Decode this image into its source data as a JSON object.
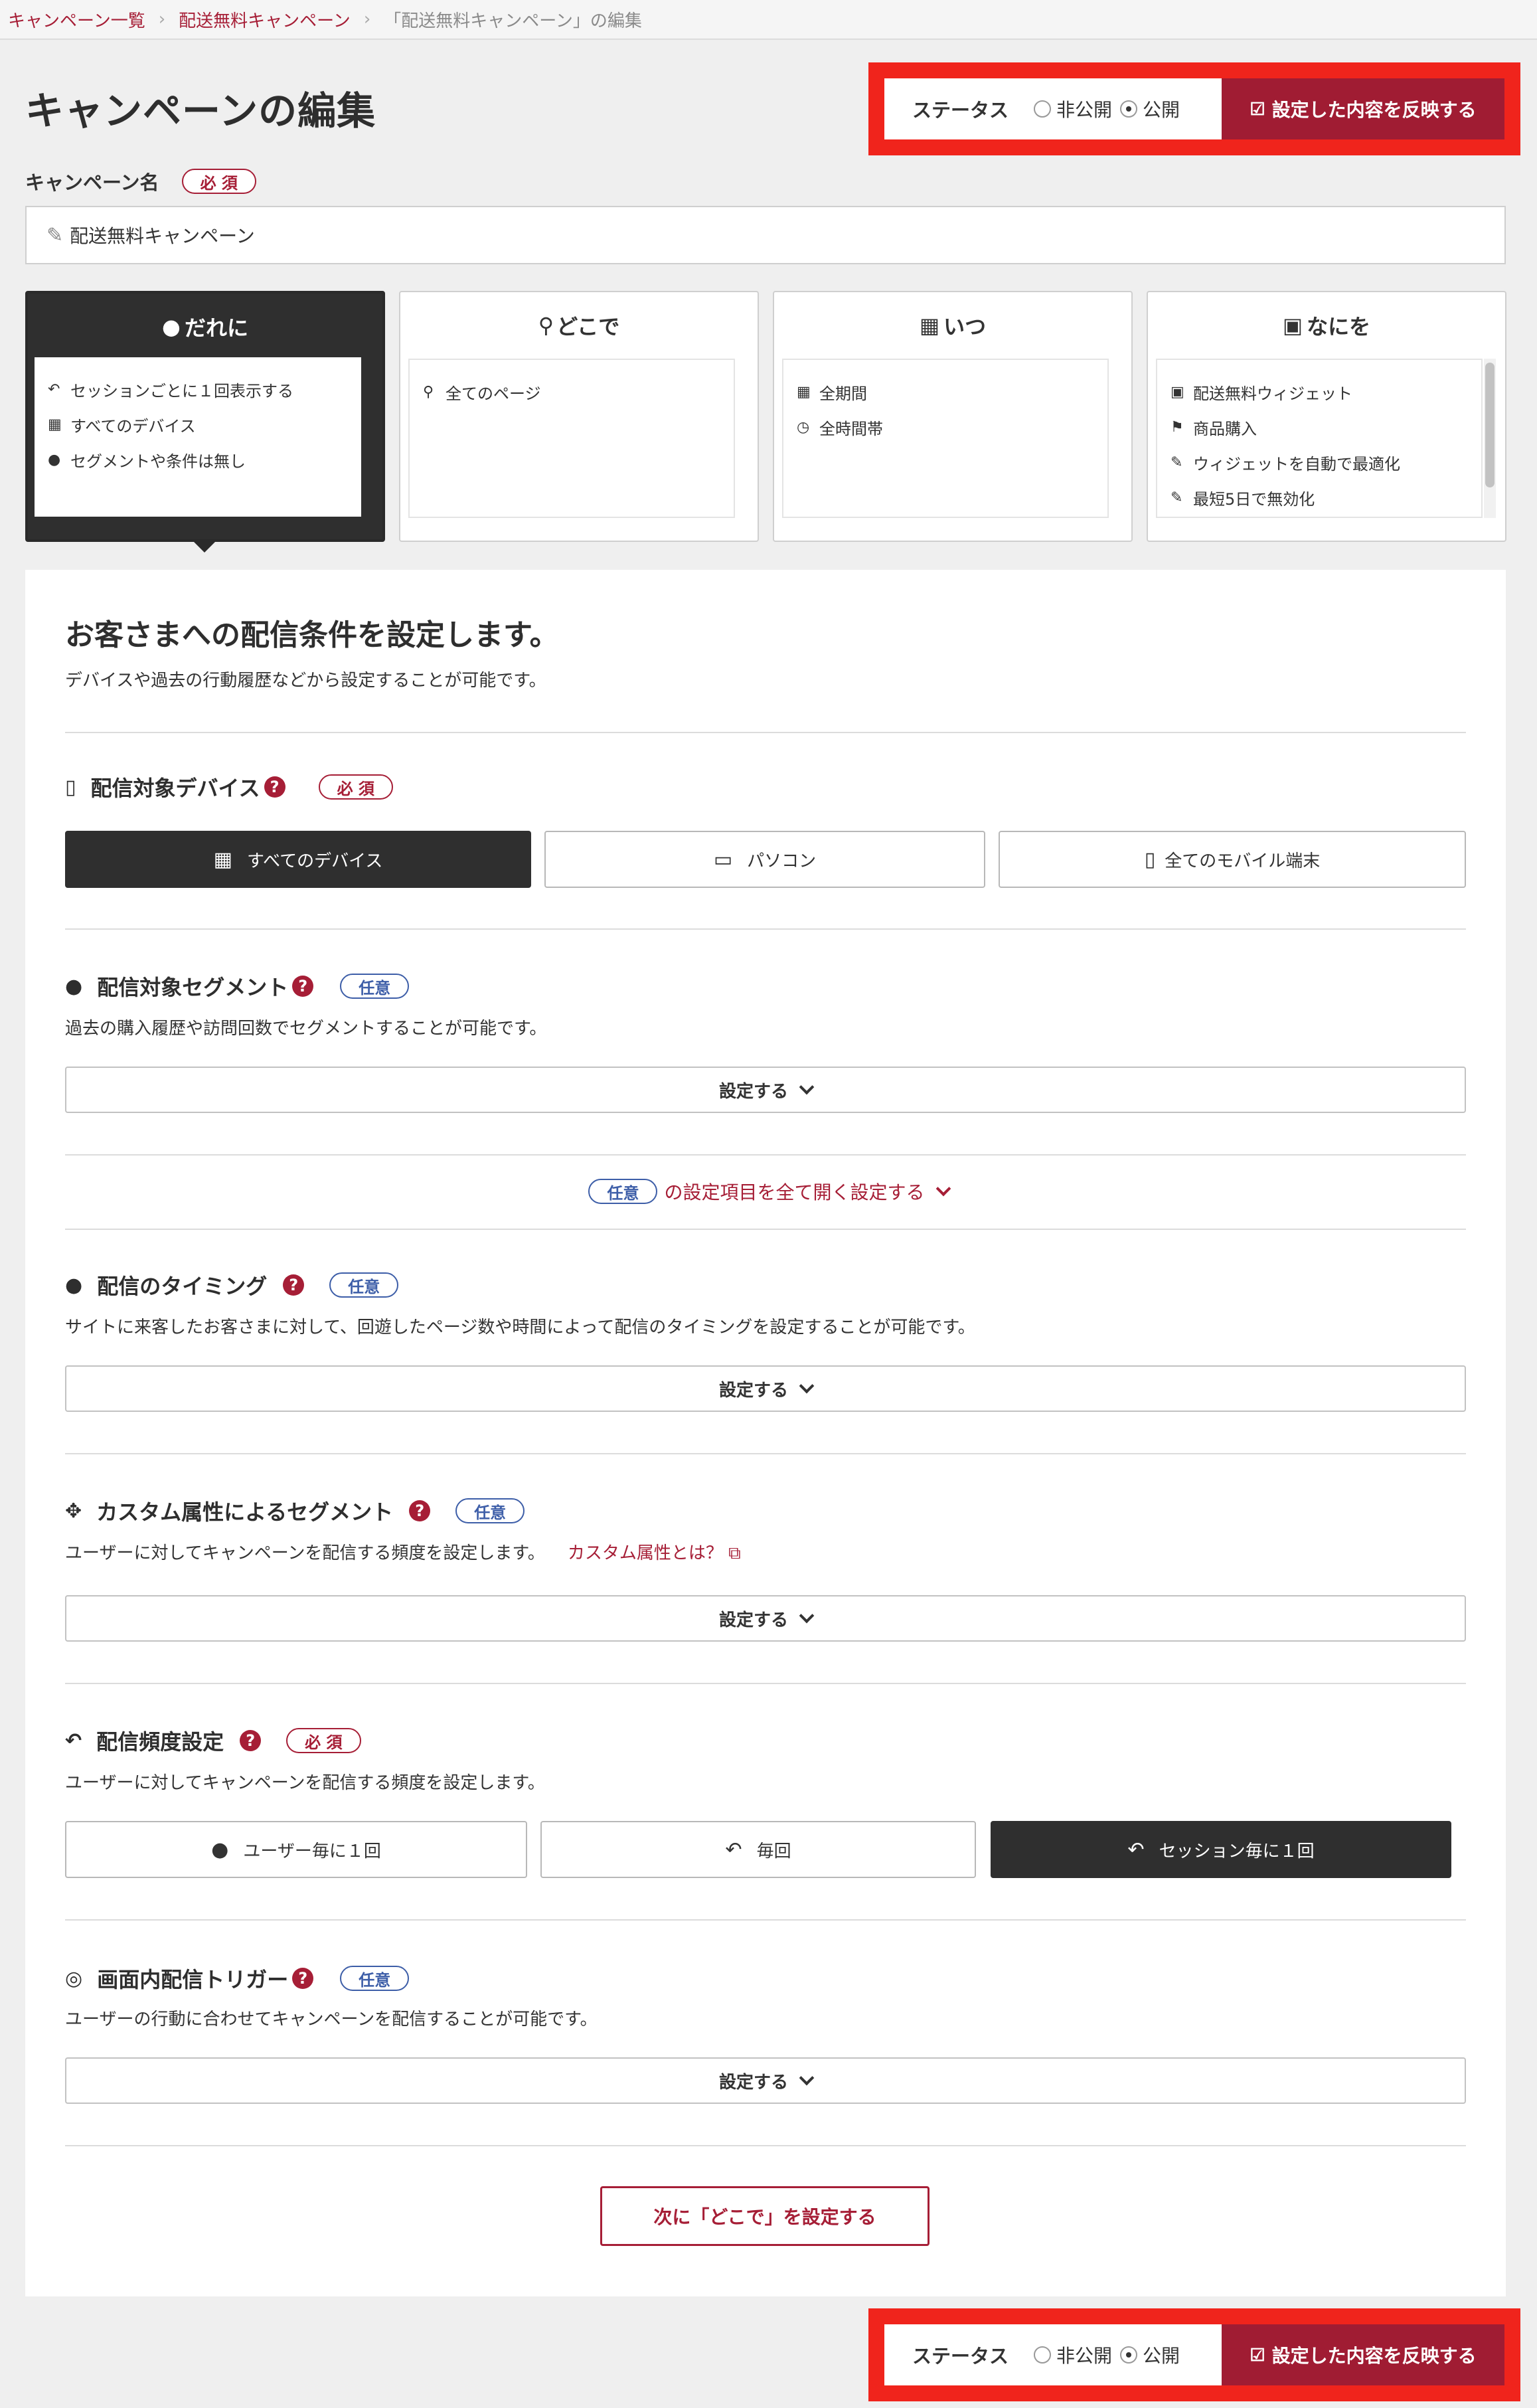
{
  "breadcrumb": {
    "items": [
      "キャンペーン一覧",
      "配送無料キャンペーン"
    ],
    "current": "「配送無料キャンペーン」の編集"
  },
  "page_title": "キャンペーンの編集",
  "status": {
    "label": "ステータス",
    "options": [
      "非公開",
      "公開"
    ],
    "selected": "公開",
    "reflect_label": "設定した内容を反映する"
  },
  "campaign_name": {
    "label": "キャンペーン名",
    "badge": "必 須",
    "value": "配送無料キャンペーン"
  },
  "steps": [
    {
      "title": "だれに",
      "icon": "user-icon",
      "items": [
        {
          "icon": "reply-icon",
          "text": "セッションごとに１回表示する"
        },
        {
          "icon": "grid-icon",
          "text": "すべてのデバイス"
        },
        {
          "icon": "user-icon",
          "text": "セグメントや条件は無し"
        }
      ]
    },
    {
      "title": "どこで",
      "icon": "map-marker-icon",
      "items": [
        {
          "icon": "map-marker-icon",
          "text": "全てのページ"
        }
      ]
    },
    {
      "title": "いつ",
      "icon": "calendar-icon",
      "items": [
        {
          "icon": "calendar-icon",
          "text": "全期間"
        },
        {
          "icon": "clock-icon",
          "text": "全時間帯"
        }
      ]
    },
    {
      "title": "なにを",
      "icon": "image-icon",
      "items": [
        {
          "icon": "image-icon",
          "text": "配送無料ウィジェット"
        },
        {
          "icon": "flag-icon",
          "text": "商品購入"
        },
        {
          "icon": "magic-wand-icon",
          "text": "ウィジェットを自動で最適化"
        },
        {
          "icon": "magic-wand-icon",
          "text": "最短5日で無効化"
        }
      ]
    }
  ],
  "panel": {
    "title": "お客さまへの配信条件を設定します。",
    "subtitle": "デバイスや過去の行動履歴などから設定することが可能です。",
    "device": {
      "title": "配信対象デバイス",
      "badge": "必 須",
      "options": [
        "すべてのデバイス",
        "パソコン",
        "全てのモバイル端末"
      ],
      "selected": "すべてのデバイス"
    },
    "segment": {
      "title": "配信対象セグメント",
      "badge": "任意",
      "desc": "過去の購入履歴や訪問回数でセグメントすることが可能です。",
      "button": "設定する"
    },
    "expand_all": {
      "badge": "任意",
      "text": "の設定項目を全て開く設定する"
    },
    "timing": {
      "title": "配信のタイミング",
      "badge": "任意",
      "desc": "サイトに来客したお客さまに対して、回遊したページ数や時間によって配信のタイミングを設定することが可能です。",
      "button": "設定する"
    },
    "custom": {
      "title": "カスタム属性によるセグメント",
      "badge": "任意",
      "desc": "ユーザーに対してキャンペーンを配信する頻度を設定します。",
      "link": "カスタム属性とは？",
      "button": "設定する"
    },
    "frequency": {
      "title": "配信頻度設定",
      "badge": "必 須",
      "desc": "ユーザーに対してキャンペーンを配信する頻度を設定します。",
      "options": [
        "ユーザー毎に１回",
        "毎回",
        "セッション毎に１回"
      ],
      "selected": "セッション毎に１回"
    },
    "trigger": {
      "title": "画面内配信トリガー",
      "badge": "任意",
      "desc": "ユーザーの行動に合わせてキャンペーンを配信することが可能です。",
      "button": "設定する"
    },
    "next_button": "次に「どこで」を設定する"
  },
  "colors": {
    "accent": "#a61e36",
    "highlight": "#f0241c",
    "dark": "#2f2f2f",
    "optional": "#3d5ea8"
  }
}
